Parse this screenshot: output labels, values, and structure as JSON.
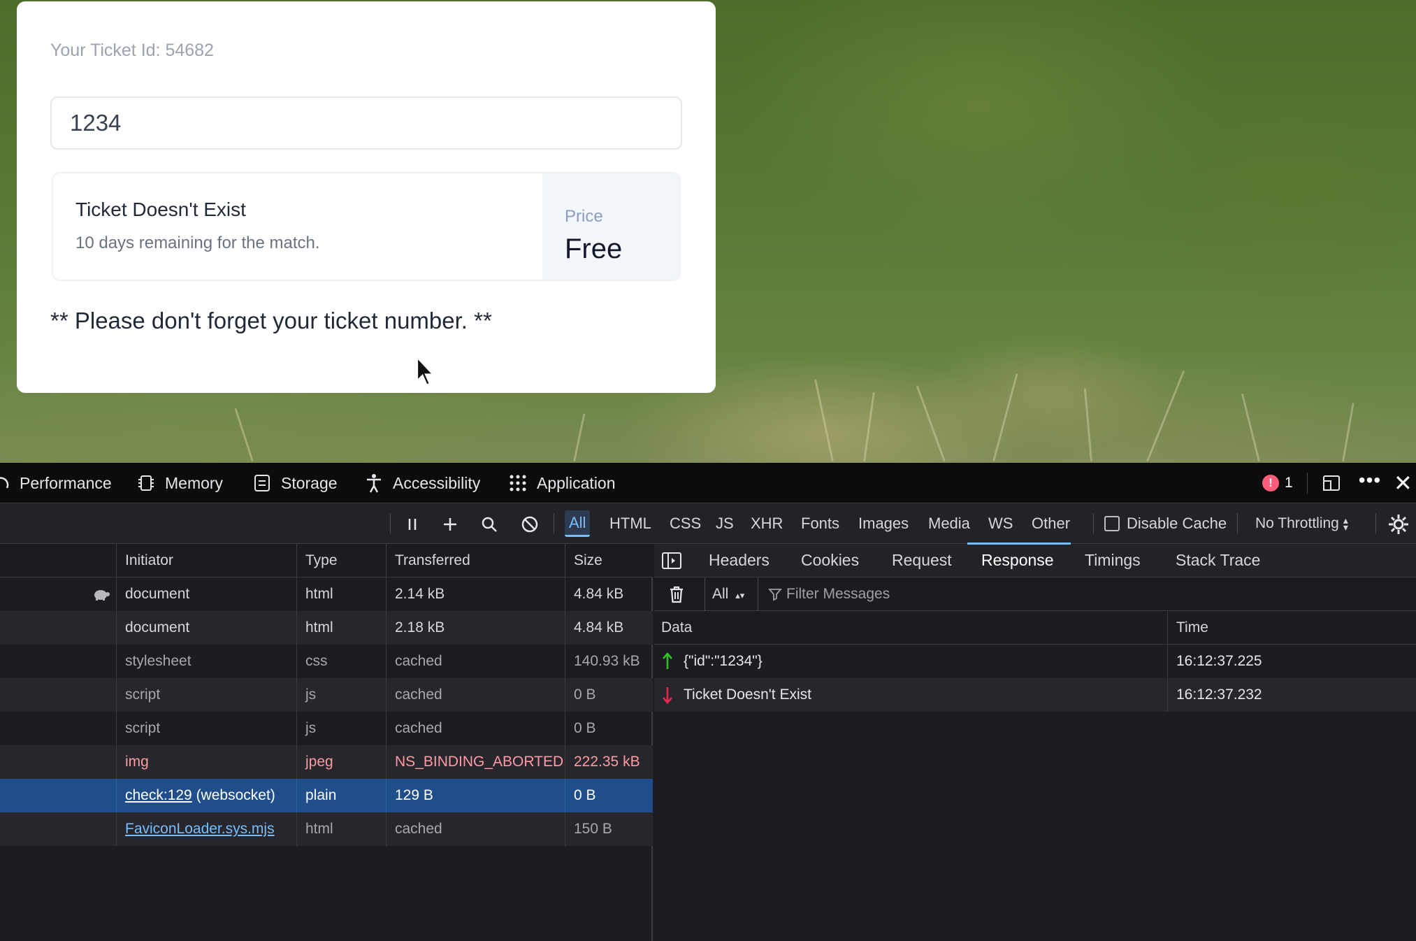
{
  "page": {
    "ticket_id_text": "Your Ticket Id: 54682",
    "ticket_input_value": "1234",
    "result_title": "Ticket Doesn't Exist",
    "result_subtitle": "10 days remaining for the match.",
    "price_label": "Price",
    "price_value": "Free",
    "reminder": "** Please don't forget your ticket number. **"
  },
  "devtools": {
    "tabs": [
      {
        "label": "Performance",
        "icon": "performance-icon"
      },
      {
        "label": "Memory",
        "icon": "memory-icon"
      },
      {
        "label": "Storage",
        "icon": "storage-icon"
      },
      {
        "label": "Accessibility",
        "icon": "accessibility-icon"
      },
      {
        "label": "Application",
        "icon": "application-icon"
      }
    ],
    "error_count": "1",
    "filters": [
      "All",
      "HTML",
      "CSS",
      "JS",
      "XHR",
      "Fonts",
      "Images",
      "Media",
      "WS",
      "Other"
    ],
    "active_filter": "All",
    "disable_cache_label": "Disable Cache",
    "throttling": "No Throttling",
    "columns": [
      "Initiator",
      "Type",
      "Transferred",
      "Size"
    ],
    "requests": [
      {
        "initiator": "document",
        "type": "html",
        "transferred": "2.14 kB",
        "size": "4.84 kB",
        "state": "normal"
      },
      {
        "initiator": "document",
        "type": "html",
        "transferred": "2.18 kB",
        "size": "4.84 kB",
        "state": "normal"
      },
      {
        "initiator": "stylesheet",
        "type": "css",
        "transferred": "cached",
        "size": "140.93 kB",
        "state": "dim"
      },
      {
        "initiator": "script",
        "type": "js",
        "transferred": "cached",
        "size": "0 B",
        "state": "dim"
      },
      {
        "initiator": "script",
        "type": "js",
        "transferred": "cached",
        "size": "0 B",
        "state": "dim"
      },
      {
        "initiator": "img",
        "type": "jpeg",
        "transferred": "NS_BINDING_ABORTED",
        "size": "222.35 kB",
        "state": "error"
      },
      {
        "initiator_link": "check:129",
        "initiator_suffix": " (websocket)",
        "type": "plain",
        "transferred": "129 B",
        "size": "0 B",
        "state": "selected"
      },
      {
        "initiator_link": "FaviconLoader.sys.mjs",
        "type": "html",
        "transferred": "cached",
        "size": "150 B",
        "state": "dim"
      }
    ],
    "detail_tabs": [
      "Headers",
      "Cookies",
      "Request",
      "Response",
      "Timings",
      "Stack Trace"
    ],
    "active_detail_tab": "Response",
    "ws_filter_select": "All",
    "ws_filter_placeholder": "Filter Messages",
    "message_columns": [
      "Data",
      "Time"
    ],
    "messages": [
      {
        "direction": "sent",
        "data": "{\"id\":\"1234\"}",
        "time": "16:12:37.225"
      },
      {
        "direction": "received",
        "data": "Ticket Doesn't Exist",
        "time": "16:12:37.232"
      }
    ],
    "colors": {
      "accent": "#75bfff",
      "selected_row": "#204e8a",
      "error_text": "#ff9aa2",
      "sent_arrow": "#2ac31f",
      "received_arrow": "#e22850"
    }
  }
}
